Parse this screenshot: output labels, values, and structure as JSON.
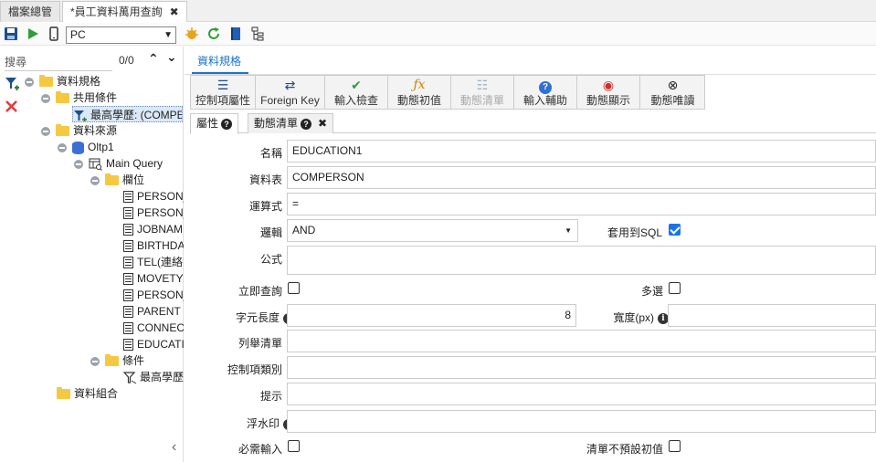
{
  "doc_tabs": [
    {
      "label": "檔案總管"
    },
    {
      "label": "*員工資料萬用查詢",
      "close": "✖"
    }
  ],
  "toolbar": {
    "device_select": "PC"
  },
  "left": {
    "search_label": "搜尋",
    "search_count": "0/0",
    "tree": {
      "root": "資料規格",
      "common_conditions": "共用條件",
      "selected_item": "最高學歷: (COMPERSON.EDUCATION)",
      "datasource": "資料來源",
      "oltp": "Oltp1",
      "main_query": "Main Query",
      "fields_folder": "欄位",
      "fields": [
        "PERSON_ID",
        "PERSON_NAME",
        "JOBNAME",
        "BIRTHDATE",
        "TEL(連絡電話)",
        "MOVETYPE",
        "PERSON_TYPE",
        "PARENT",
        "CONNECTOR",
        "EDUCATION"
      ],
      "conditions_folder": "條件",
      "condition_item": "最高學歷",
      "data_combine": "資料組合"
    }
  },
  "right": {
    "main_tab": "資料規格",
    "buttons": [
      {
        "label": "控制項屬性",
        "icon": "☰",
        "color": "#1f4e8c",
        "disabled": false
      },
      {
        "label": "Foreign Key",
        "icon": "⇄",
        "color": "#1f4e8c",
        "disabled": false
      },
      {
        "label": "輸入檢查",
        "icon": "✔",
        "color": "#2e9e3a",
        "disabled": false
      },
      {
        "label": "動態初值",
        "icon": "ƒx",
        "color": "#c9820f",
        "disabled": false
      },
      {
        "label": "動態清單",
        "icon": "☷",
        "color": "#9bb0c8",
        "disabled": true
      },
      {
        "label": "輸入輔助",
        "icon": "?",
        "color": "#2f6fd6",
        "disabled": false
      },
      {
        "label": "動態顯示",
        "icon": "◉",
        "color": "#c8322c",
        "disabled": false
      },
      {
        "label": "動態唯讀",
        "icon": "⊗",
        "color": "#222222",
        "disabled": false
      }
    ],
    "subtabs": [
      {
        "label": "屬性"
      },
      {
        "label": "動態清單",
        "close": "✖"
      }
    ],
    "form": {
      "name_label": "名稱",
      "name_value": "EDUCATION1",
      "table_label": "資料表",
      "table_value": "COMPERSON",
      "operator_label": "運算式",
      "operator_value": "=",
      "logic_label": "邏輯",
      "logic_value": "AND",
      "apply_sql_label": "套用到SQL",
      "formula_label": "公式",
      "instant_query_label": "立即查詢",
      "multi_select_label": "多選",
      "char_length_label": "字元長度",
      "char_length_value": "8",
      "width_label": "寬度(px)",
      "enum_list_label": "列舉清單",
      "control_type_label": "控制項類別",
      "hint_label": "提示",
      "watermark_label": "浮水印",
      "required_label": "必需輸入",
      "no_default_label": "清單不預設初值"
    }
  }
}
